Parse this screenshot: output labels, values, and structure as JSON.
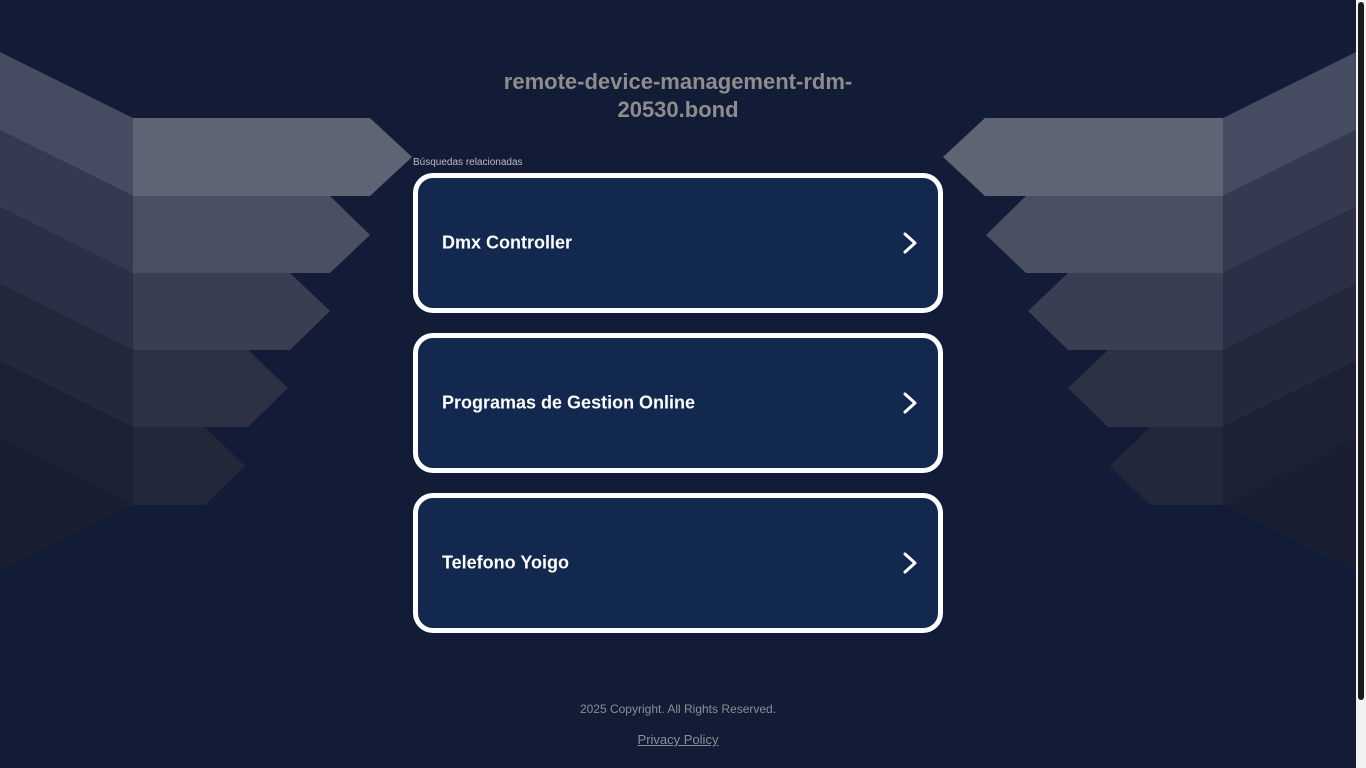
{
  "page": {
    "domain_title": "remote-device-management-rdm-20530.bond",
    "related_label": "Búsquedas relacionadas",
    "copyright": "2025 Copyright. All Rights Reserved.",
    "privacy_label": "Privacy Policy"
  },
  "links": [
    {
      "label": "Dmx Controller",
      "icon": "chevron-right-icon"
    },
    {
      "label": "Programas de Gestion Online",
      "icon": "chevron-right-icon"
    },
    {
      "label": "Telefono Yoigo",
      "icon": "chevron-right-icon"
    }
  ],
  "colors": {
    "background": "#121c36",
    "card_fill": "#12284f",
    "card_border": "#ffffff",
    "title_text": "#8d8d8d"
  }
}
